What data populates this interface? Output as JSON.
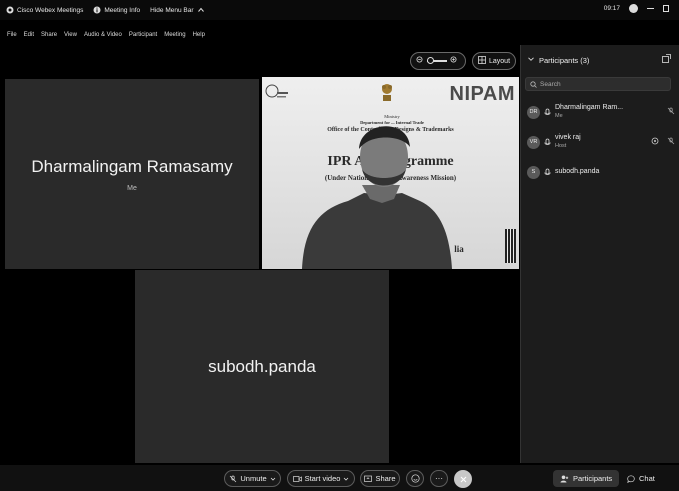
{
  "titlebar": {
    "app_name": "Cisco Webex Meetings",
    "meeting_info": "Meeting Info",
    "hide_menu_bar": "Hide Menu Bar",
    "clock": "09:17"
  },
  "menu": [
    "File",
    "Edit",
    "Share",
    "View",
    "Audio & Video",
    "Participant",
    "Meeting",
    "Help"
  ],
  "view_controls": {
    "layout_label": "Layout"
  },
  "tiles": {
    "dharmalingam": {
      "name": "Dharmalingam Ramasamy",
      "sub": "Me"
    },
    "subodh": {
      "name": "subodh.panda"
    }
  },
  "video_banner": {
    "brand": "NIPAM",
    "line1": "Ministry",
    "line2": "Department for ... Internal Trade",
    "line3": "Office of the Controller ... Designs & Trademarks",
    "headline": "IPR Aw ... rogramme",
    "subline": "(Under National I ... rty Awareness Mission)",
    "fragment": "lia"
  },
  "panel": {
    "title": "Participants (3)",
    "search_placeholder": "Search",
    "participants": [
      {
        "initials": "DR",
        "name": "Dharmalingam Ram...",
        "role": "Me"
      },
      {
        "initials": "VR",
        "name": "vivek raj",
        "role": "Host"
      },
      {
        "initials": "S",
        "name": "subodh.panda",
        "role": ""
      }
    ]
  },
  "bottombar": {
    "unmute": "Unmute",
    "start_video": "Start video",
    "share": "Share",
    "participants": "Participants",
    "chat": "Chat"
  },
  "colors": {
    "background": "#000000",
    "tile": "#2a2a2a",
    "panel": "#1c1c1c"
  }
}
